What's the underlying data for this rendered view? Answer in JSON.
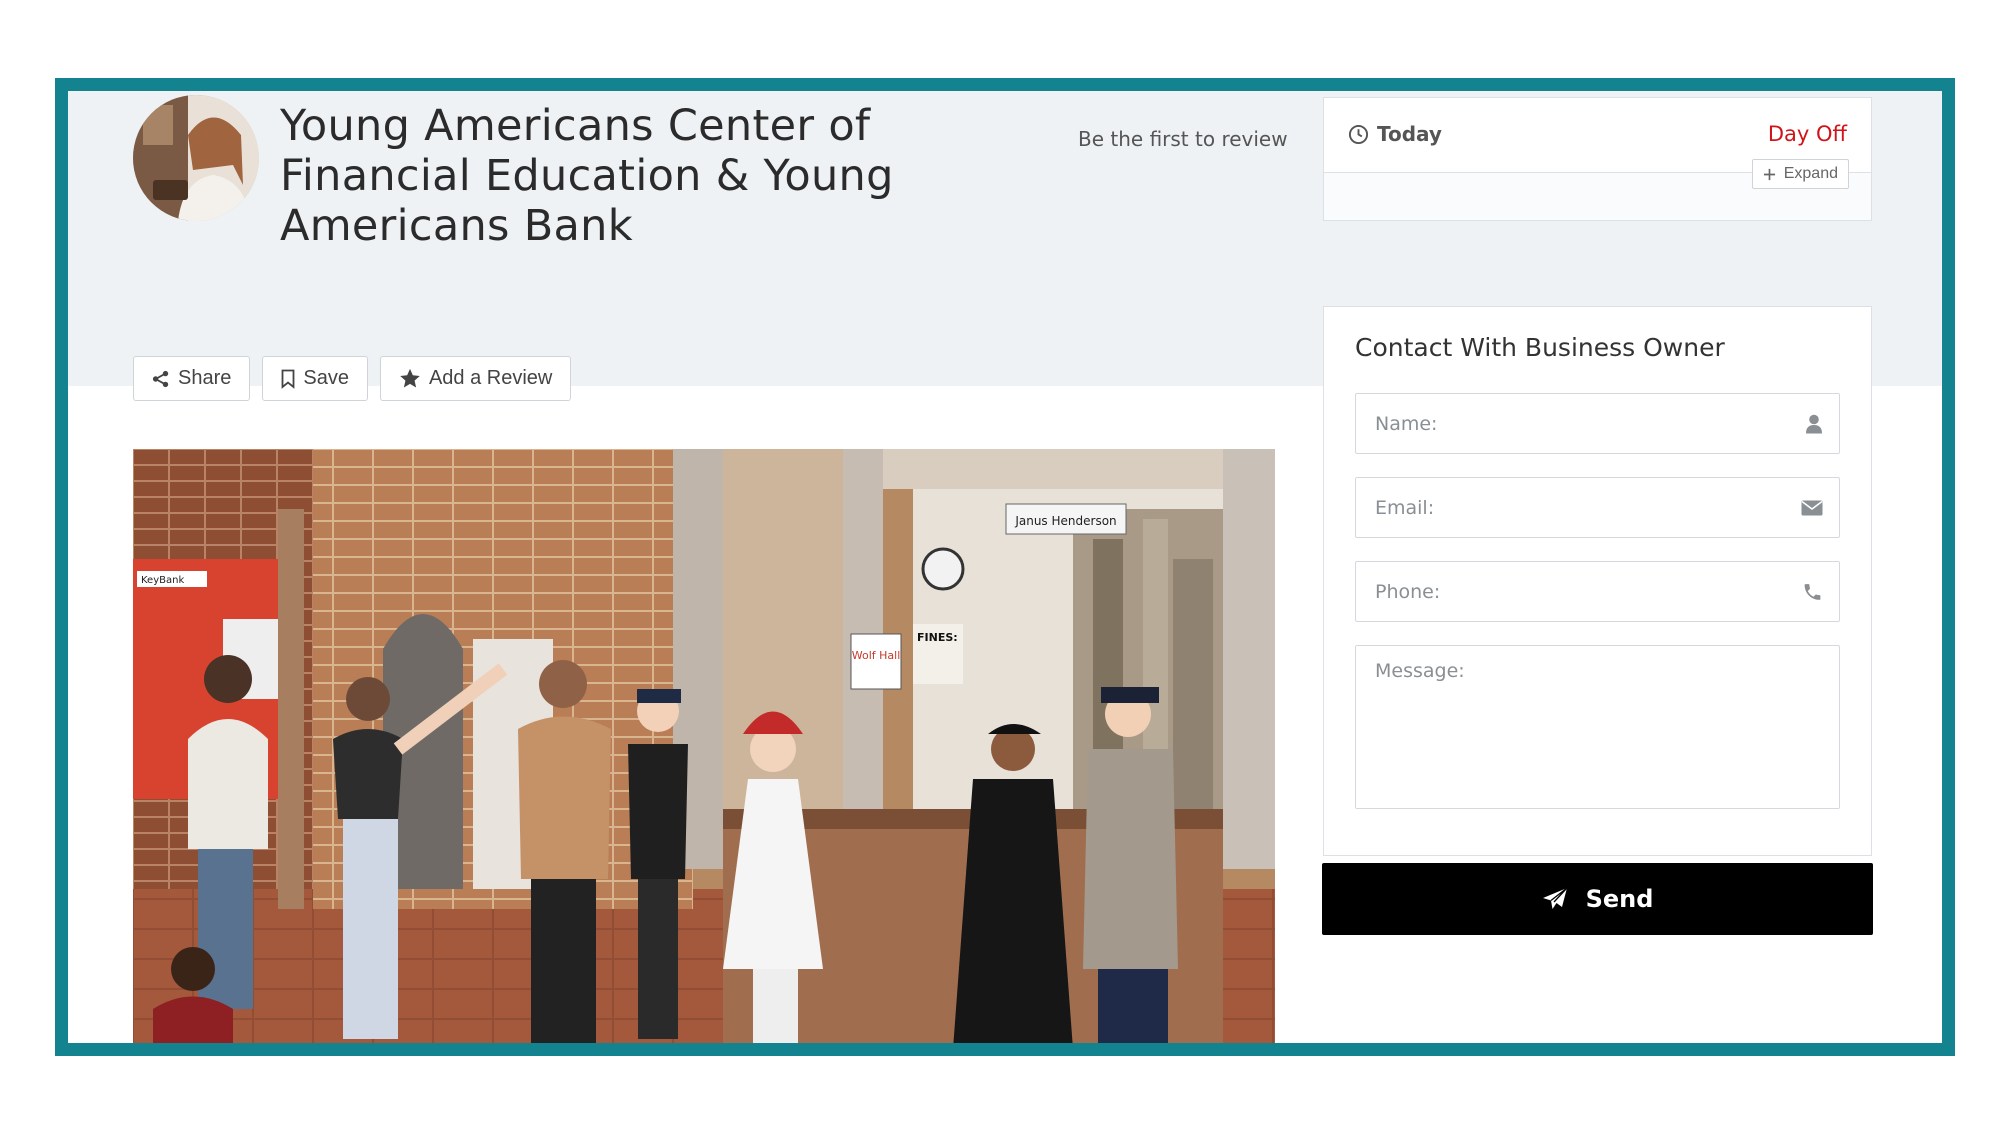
{
  "business": {
    "title": "Young Americans Center of Financial Education & Young Americans Bank",
    "review_prompt": "Be the first to review"
  },
  "actions": {
    "share_label": "Share",
    "save_label": "Save",
    "review_label": "Add a Review"
  },
  "hours": {
    "label": "Today",
    "status": "Day Off",
    "expand_label": "Expand",
    "status_color": "#d0141a"
  },
  "contact": {
    "title": "Contact With Business Owner",
    "name_placeholder": "Name:",
    "email_placeholder": "Email:",
    "phone_placeholder": "Phone:",
    "message_placeholder": "Message:",
    "send_label": "Send"
  },
  "photo": {
    "signs": {
      "key_bank": "KeyBank",
      "janus": "Janus Henderson",
      "wolf_hall": "Wolf Hall",
      "fines": "FINES:"
    }
  },
  "theme": {
    "frame_color": "#13838f",
    "band_color": "#eff2f5",
    "send_bg": "#000000"
  }
}
